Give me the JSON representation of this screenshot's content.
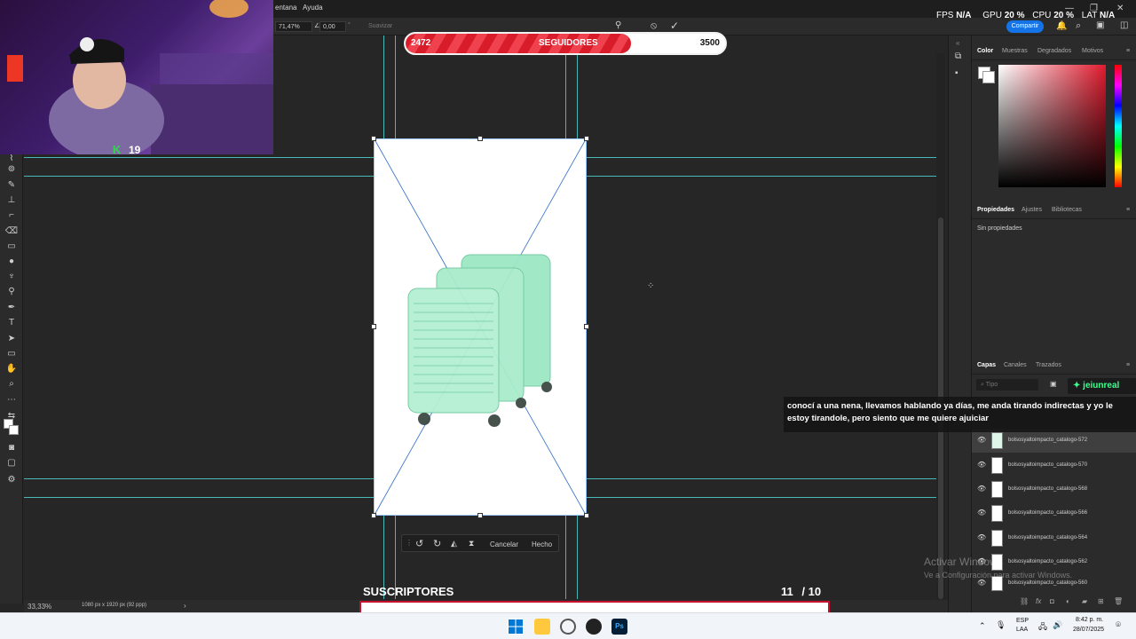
{
  "menubar": {
    "items": [
      "entana",
      "Ayuda"
    ]
  },
  "stats": {
    "fps_label": "FPS",
    "fps_value": "N/A",
    "gpu_label": "GPU",
    "gpu_value": "20 %",
    "cpu_label": "CPU",
    "cpu_value": "20 %",
    "lat_label": "LAT",
    "lat_value": "N/A"
  },
  "options": {
    "zoom": "71,47%",
    "angle": "0,00",
    "smooth": "Suavizar"
  },
  "share_label": "Compartir",
  "followers": {
    "current": "2472",
    "label": "SEGUIDORES",
    "goal": "3500",
    "progress": 0.706
  },
  "webcam": {
    "badge_value": "19"
  },
  "transform": {
    "cancel": "Cancelar",
    "done": "Hecho"
  },
  "status": {
    "zoom": "33,33%",
    "doc_size": "1080 px x 1920 px (92 ppp)"
  },
  "color_panel": {
    "tabs": [
      "Color",
      "Muestras",
      "Degradados",
      "Motivos"
    ]
  },
  "properties_panel": {
    "tabs": [
      "Propiedades",
      "Ajustes",
      "Bibliotecas"
    ],
    "empty": "Sin propiedades"
  },
  "layers_panel": {
    "tabs": [
      "Capas",
      "Canales",
      "Trazados"
    ],
    "search_placeholder": "Tipo",
    "layers": [
      "bolsosyaltoimpacto_catalogo-572",
      "bolsosyaltoimpacto_catalogo-570",
      "bolsosyaltoimpacto_catalogo-568",
      "bolsosyaltoimpacto_catalogo-566",
      "bolsosyaltoimpacto_catalogo-564",
      "bolsosyaltoimpacto_catalogo-562",
      "bolsosyaltoimpacto_catalogo-560"
    ]
  },
  "chat": {
    "user": "jeiunreal",
    "message": "conocí a una nena, llevamos hablando ya días, me anda tirando indirectas y yo le estoy tirandole, pero siento que me quiere ajuiciar"
  },
  "subscribers": {
    "label": "SUSCRIPTORES",
    "current": "11",
    "separator": "/",
    "goal": "10",
    "progress": 1.0
  },
  "watermark": {
    "line1": "Activar Windows",
    "line2": "Ve a Configuración para activar Windows."
  },
  "taskbar": {
    "lang1": "ESP",
    "lang2": "LAA",
    "time": "8:42 p. m.",
    "date": "28/07/2025"
  },
  "colors": {
    "guide": "#4fd4d0",
    "accent": "#1473e6",
    "followers_red": "#d91c2a",
    "subs_border": "#c8102e",
    "chat_user": "#3cff8d"
  }
}
